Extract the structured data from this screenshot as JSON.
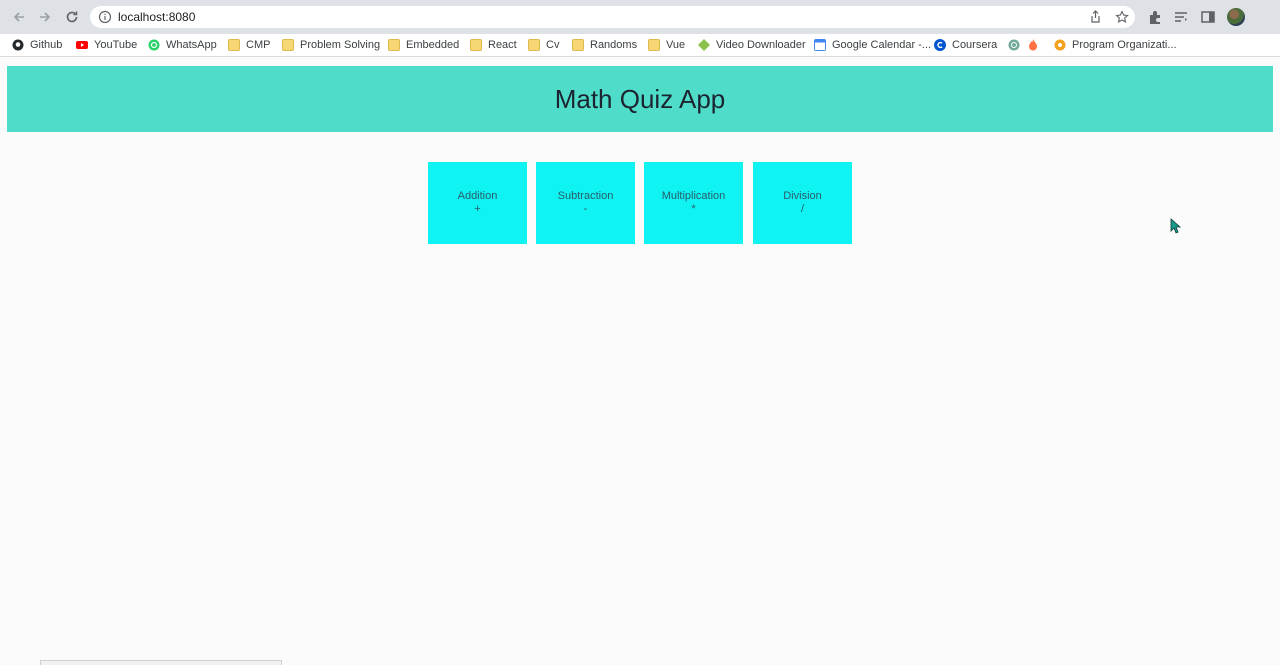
{
  "browser": {
    "url": "localhost:8080",
    "bookmarks": [
      {
        "label": "Github",
        "icon": "github-icon"
      },
      {
        "label": "YouTube",
        "icon": "youtube-icon"
      },
      {
        "label": "WhatsApp",
        "icon": "whatsapp-icon"
      },
      {
        "label": "CMP",
        "icon": "folder-icon"
      },
      {
        "label": "Problem Solving",
        "icon": "folder-icon"
      },
      {
        "label": "Embedded",
        "icon": "folder-icon"
      },
      {
        "label": "React",
        "icon": "folder-icon"
      },
      {
        "label": "Cv",
        "icon": "folder-icon"
      },
      {
        "label": "Randoms",
        "icon": "folder-icon"
      },
      {
        "label": "Vue",
        "icon": "folder-icon"
      },
      {
        "label": "Video Downloader",
        "icon": "android-icon"
      },
      {
        "label": "Google Calendar -...",
        "icon": "calendar-icon"
      },
      {
        "label": "Coursera",
        "icon": "coursera-icon"
      },
      {
        "label": "",
        "icon": "openai-icon"
      },
      {
        "label": "",
        "icon": "fire-icon"
      },
      {
        "label": "Program Organizati...",
        "icon": "gear-icon"
      }
    ]
  },
  "app": {
    "title": "Math Quiz App",
    "operations": [
      {
        "name": "Addition",
        "symbol": "+"
      },
      {
        "name": "Subtraction",
        "symbol": "-"
      },
      {
        "name": "Multiplication",
        "symbol": "*"
      },
      {
        "name": "Division",
        "symbol": "/"
      }
    ]
  },
  "colors": {
    "header_bg": "#4fdcc8",
    "tile_bg": "#0ff3f3",
    "page_bg": "#fbfbfb"
  }
}
